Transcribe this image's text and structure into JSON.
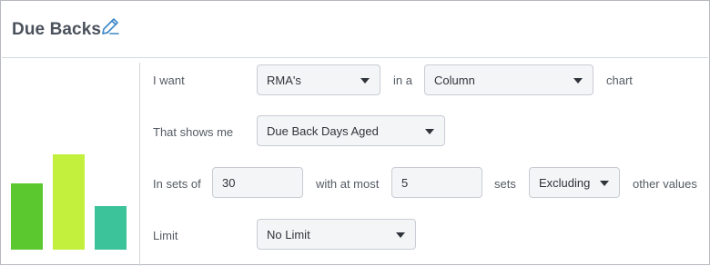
{
  "header": {
    "title": "Due Backs",
    "edit_icon": "pencil-icon"
  },
  "preview": {
    "bars": [
      {
        "color": "#5cc830",
        "level": 0.5
      },
      {
        "color": "#c2f03c",
        "level": 0.72
      },
      {
        "color": "#3cc39a",
        "level": 0.33
      }
    ]
  },
  "form": {
    "row1": {
      "label": "I want",
      "metric": "RMA's",
      "connector": "in a",
      "chart_type": "Column",
      "suffix": "chart"
    },
    "row2": {
      "label": "That shows me",
      "measure": "Due Back Days Aged"
    },
    "row3": {
      "label": "In sets of",
      "set_size": "30",
      "connector": "with at most",
      "max_sets": "5",
      "sets_label": "sets",
      "mode": "Excluding",
      "suffix": "other values"
    },
    "row4": {
      "label": "Limit",
      "limit": "No Limit"
    }
  }
}
